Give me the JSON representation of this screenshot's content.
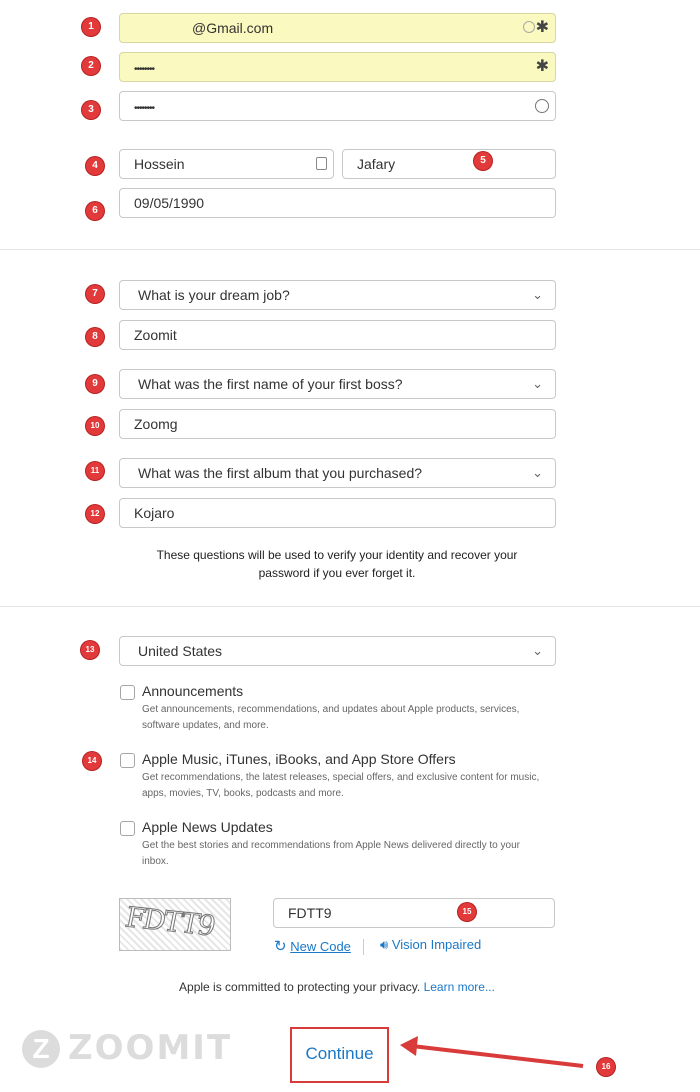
{
  "account": {
    "email_value": "@Gmail.com",
    "password_mask": "••••••••",
    "confirm_mask": "••••••••"
  },
  "name": {
    "first": "Hossein",
    "last": "Jafary"
  },
  "birthday": "09/05/1990",
  "security": {
    "q1": "What is your dream job?",
    "a1": "Zoomit",
    "q2": "What was the first name of your first boss?",
    "a2": "Zoomg",
    "q3": "What was the first album that you purchased?",
    "a3": "Kojaro",
    "note_line1": "These questions will be used to verify your identity and recover your",
    "note_line2": "password if you ever forget it."
  },
  "country": "United States",
  "options": [
    {
      "title": "Announcements",
      "desc1": "Get announcements, recommendations, and updates about Apple products, services,",
      "desc2": "software updates, and more."
    },
    {
      "title": "Apple Music, iTunes, iBooks, and App Store Offers",
      "desc1": "Get recommendations, the latest releases, special offers, and exclusive content for music,",
      "desc2": "apps, movies, TV, books, podcasts and more."
    },
    {
      "title": "Apple News Updates",
      "desc1": "Get the best stories and recommendations from Apple News delivered directly to your",
      "desc2": "inbox."
    }
  ],
  "captcha": {
    "image_text": "FDTT9",
    "input_value": "FDTT9",
    "new_code": "New Code",
    "vision": "Vision Impaired"
  },
  "privacy": {
    "text": "Apple is committed to protecting your privacy. ",
    "link": "Learn more..."
  },
  "continue_label": "Continue",
  "watermark": "ZOOMIT",
  "badges": [
    "1",
    "2",
    "3",
    "4",
    "5",
    "6",
    "7",
    "8",
    "9",
    "10",
    "11",
    "12",
    "13",
    "14",
    "15",
    "16"
  ],
  "colors": {
    "badge": "#e23a3a",
    "link": "#1a78c6",
    "highlight_box": "#d93a3a",
    "autofill": "#faf9c0"
  }
}
